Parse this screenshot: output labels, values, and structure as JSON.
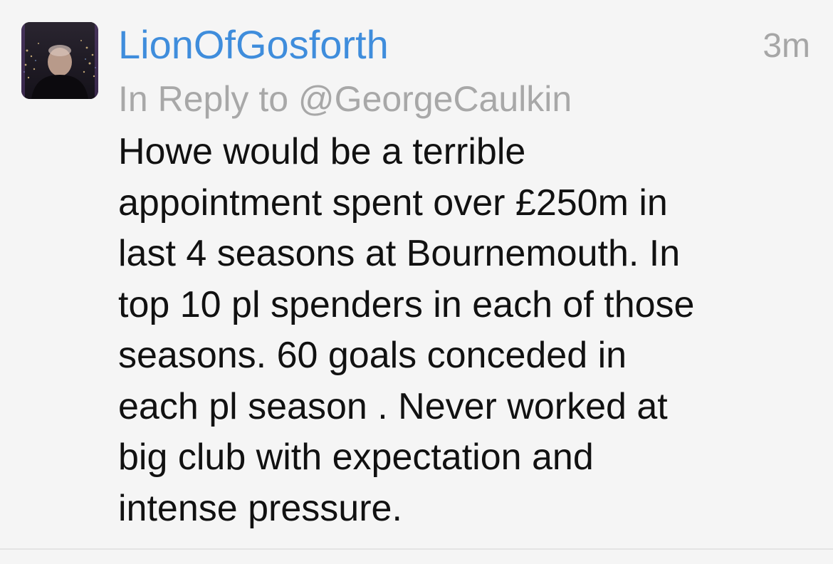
{
  "tweet": {
    "avatar_icon": "user-avatar-photo",
    "username": "LionOfGosforth",
    "time": "3m",
    "reply_prefix": "In Reply to",
    "reply_handle": "@GeorgeCaulkin",
    "text": "Howe would be a terrible\nappointment spent over £250m in\nlast  4 seasons at Bournemouth.  In\ntop 10 pl spenders in each of those\nseasons.   60 goals conceded in\neach pl season .  Never worked at\nbig club with expectation and\nintense pressure."
  },
  "colors": {
    "background": "#f5f5f5",
    "username": "#3f8ddc",
    "meta": "#a8a8a8",
    "text": "#111111"
  }
}
